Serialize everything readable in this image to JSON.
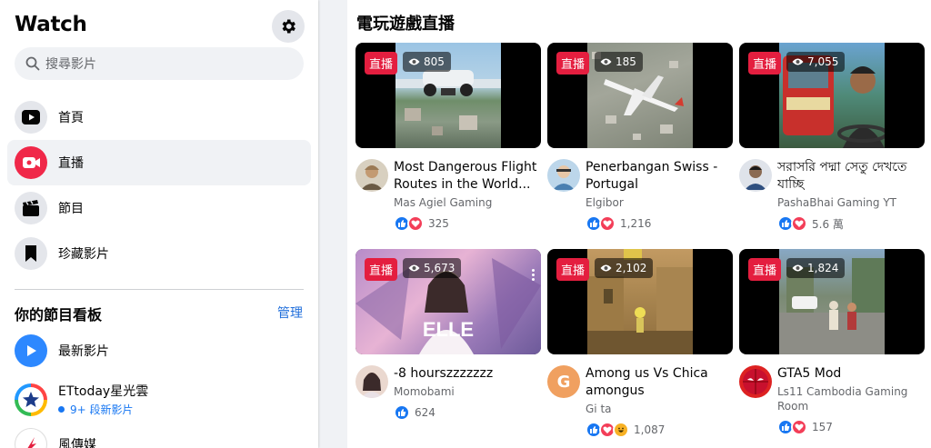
{
  "sidebar": {
    "title": "Watch",
    "search_placeholder": "搜尋影片",
    "nav": [
      {
        "label": "首頁",
        "icon": "watch-home-icon",
        "active": false
      },
      {
        "label": "直播",
        "icon": "live-icon",
        "active": true
      },
      {
        "label": "節目",
        "icon": "clapperboard-icon",
        "active": false
      },
      {
        "label": "珍藏影片",
        "icon": "bookmark-icon",
        "active": false
      }
    ],
    "shows_title": "你的節目看板",
    "manage_label": "管理",
    "shows": [
      {
        "name": "最新影片",
        "sub": ""
      },
      {
        "name": "ETtoday星光雲",
        "sub": "9+ 段新影片"
      },
      {
        "name": "風傳媒",
        "sub": ""
      }
    ]
  },
  "main": {
    "section_title": "電玩遊戲直播",
    "live_label": "直播",
    "videos": [
      {
        "title": "Most Dangerous Flight Routes in the World...",
        "channel": "Mas Agiel Gaming",
        "viewers": "805",
        "reaction_count": "325"
      },
      {
        "title": "Penerbangan Swiss - Portugal",
        "channel": "Elgibor",
        "viewers": "185",
        "reaction_count": "1,216"
      },
      {
        "title": "সরাসরি পদ্মা সেতু দেখতে যাচ্ছি",
        "channel": "PashaBhai Gaming YT",
        "viewers": "7,055",
        "reaction_count": "5.6 萬"
      },
      {
        "title": "-8 hourszzzzzzz",
        "channel": "Momobami",
        "viewers": "5,673",
        "reaction_count": "624"
      },
      {
        "title": "Among us Vs Chica amongus",
        "channel": "Gi ta",
        "viewers": "2,102",
        "reaction_count": "1,087"
      },
      {
        "title": "GTA5 Mod",
        "channel": "Ls11 Cambodia Gaming Room",
        "viewers": "1,824",
        "reaction_count": "157"
      }
    ]
  },
  "colors": {
    "accent": "#1877f2",
    "live_red": "#e41e3f",
    "like_blue": "#1877f2",
    "love_red": "#f33e58"
  }
}
